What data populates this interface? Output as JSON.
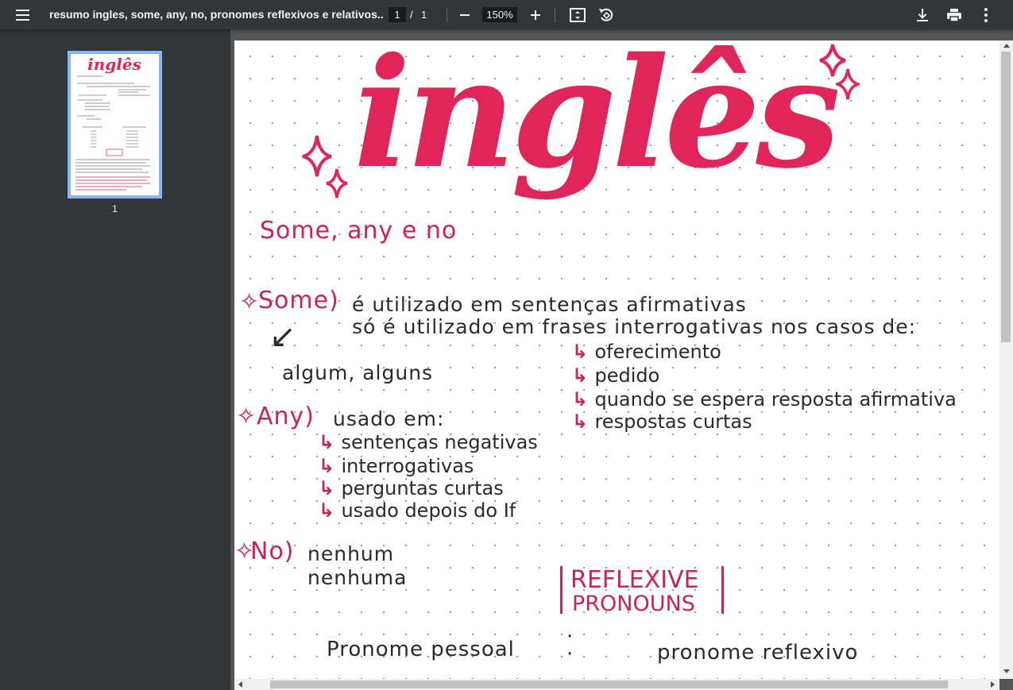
{
  "toolbar": {
    "title": "resumo ingles, some, any, no, pronomes reflexivos e relativos..p...",
    "page_current": "1",
    "page_separator": "/",
    "page_total": "1",
    "zoom": "150%",
    "icons": [
      "menu-icon",
      "zoom-out-icon",
      "zoom-in-icon",
      "fit-page-icon",
      "rotate-icon",
      "download-icon",
      "print-icon",
      "more-icon"
    ]
  },
  "sidebar": {
    "thumbnail_label": "1"
  },
  "page": {
    "heading": "inglês",
    "subheading": "Some, any e no",
    "some_label": "Some)",
    "some_line1": "é utilizado em sentenças afirmativas",
    "some_line2": "só é utilizado em frases interrogativas nos casos de:",
    "some_cases": [
      "oferecimento",
      "pedido",
      "quando se espera resposta afirmativa",
      "respostas curtas"
    ],
    "some_meaning": "algum, alguns",
    "any_label": "Any)",
    "any_line": "usado em:",
    "any_cases": [
      "sentenças negativas",
      "interrogativas",
      "perguntas curtas",
      "usado depois do If"
    ],
    "no_label": "No)",
    "no_meanings": [
      "nenhum",
      "nenhuma"
    ],
    "reflexive_box": [
      "REFLEXIVE",
      "PRONOUNS"
    ],
    "table_left": "Pronome pessoal",
    "table_right": "pronome reflexivo"
  },
  "colors": {
    "accent": "#e0255b",
    "ink": "#2a2a2a",
    "toolbar_bg": "#323639",
    "viewer_bg": "#525659"
  }
}
